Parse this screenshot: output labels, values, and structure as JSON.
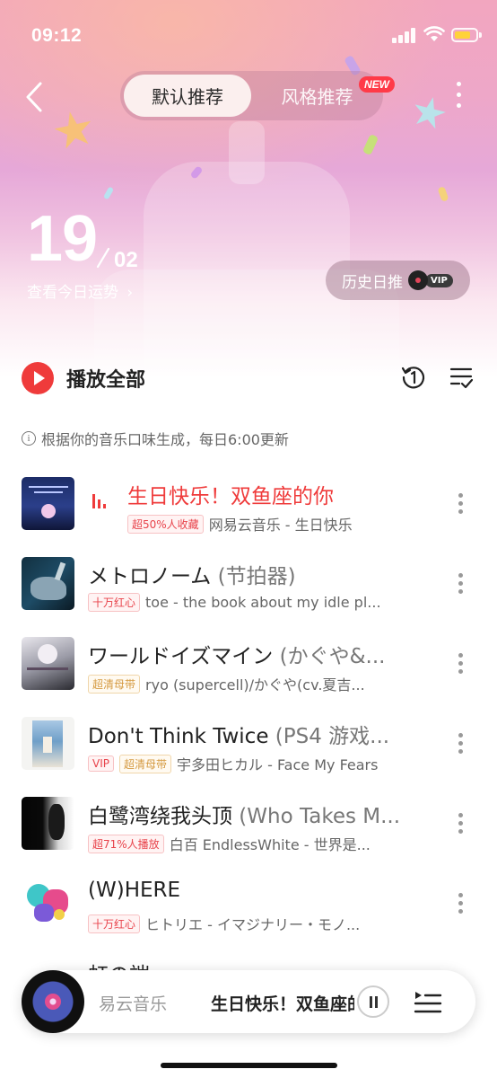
{
  "status": {
    "time": "09:12"
  },
  "header": {
    "tabs": [
      {
        "label": "默认推荐",
        "active": true
      },
      {
        "label": "风格推荐",
        "active": false
      }
    ],
    "new_badge": "NEW"
  },
  "date": {
    "day": "19",
    "month": "02",
    "fortune_link": "查看今日运势"
  },
  "history": {
    "label": "历史日推",
    "vip": "VIP"
  },
  "controls": {
    "play_all": "播放全部"
  },
  "info": {
    "text": "根据你的音乐口味生成，每日6:00更新"
  },
  "songs": [
    {
      "title": "生日快乐！双鱼座的你",
      "subtitle": "",
      "tags": [
        {
          "text": "超50%人收藏",
          "style": "red"
        }
      ],
      "artist": "网易云音乐 - 生日快乐",
      "playing": true
    },
    {
      "title": "メトロノーム",
      "subtitle": " (节拍器)",
      "tags": [
        {
          "text": "十万红心",
          "style": "red"
        }
      ],
      "artist": "toe - the book about my idle pl...",
      "playing": false
    },
    {
      "title": "ワールドイズマイン",
      "subtitle": " (かぐや&...",
      "tags": [
        {
          "text": "超清母带",
          "style": "gold"
        }
      ],
      "artist": "ryo (supercell)/かぐや(cv.夏吉...",
      "playing": false
    },
    {
      "title": "Don't Think Twice",
      "subtitle": " (PS4 游戏...",
      "tags": [
        {
          "text": "VIP",
          "style": "red"
        },
        {
          "text": "超清母带",
          "style": "gold"
        }
      ],
      "artist": "宇多田ヒカル - Face My Fears",
      "playing": false
    },
    {
      "title": "白鹭湾绕我头顶",
      "subtitle": " (Who Takes M...",
      "tags": [
        {
          "text": "超71%人播放",
          "style": "red"
        }
      ],
      "artist": "白百 EndlessWhite - 世界是...",
      "playing": false
    },
    {
      "title": "(W)HERE",
      "subtitle": "",
      "tags": [
        {
          "text": "十万红心",
          "style": "red"
        }
      ],
      "artist": "ヒトリエ - イマジナリー・モノ...",
      "playing": false
    }
  ],
  "partial_song": {
    "title": "虹の端"
  },
  "mini_player": {
    "left_text": "易云音乐",
    "title": "生日快乐！双鱼座的你"
  },
  "colors": {
    "accent": "#ef3b3b",
    "gold_tag": "#d59a42"
  },
  "icons": [
    "back-icon",
    "more-icon",
    "play-icon",
    "single-loop-icon",
    "multi-select-icon",
    "info-icon",
    "pause-icon",
    "playlist-icon"
  ]
}
